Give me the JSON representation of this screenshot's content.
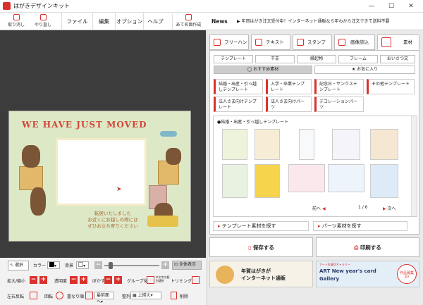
{
  "window": {
    "title": "はがきデザインキット",
    "minimize": "—",
    "maximize": "☐",
    "close": "✕"
  },
  "toolbar": {
    "undo": "取り消し",
    "redo": "やり直し",
    "menus": [
      "ファイル",
      "編集",
      "オプション",
      "ヘルプ"
    ],
    "address_button": "あて名面作成",
    "news_label": "News",
    "news_text": "▶ 年賀はがき注文受付中！インターネット通販なら年わから注文できて送料不要"
  },
  "card": {
    "headline": "WE HAVE JUST MOVED",
    "message_lines": [
      "転居いたしました",
      "お近くにお越しの際には",
      "ぜひお立ち寄りください"
    ]
  },
  "bottom_tools": {
    "select": "選択",
    "color_label": "カラー",
    "background_label": "背景",
    "show_all": "全体表示",
    "zoom": "拡大/縮小",
    "opacity": "透明度",
    "blur": "ぼかす",
    "group": "グループ化",
    "group_hint": "※文字は個別選択",
    "trim": "トリミング",
    "flip": "左右反転",
    "rotate": "回転",
    "stacking": "重なり順",
    "stacking_value": "最前面へ",
    "align": "整列",
    "align_value": "上揃え",
    "delete": "削除"
  },
  "right_panel": {
    "tabs": [
      "フリーハンド",
      "テキスト",
      "スタンプ",
      "画像読込",
      "素材"
    ],
    "subtabs": [
      "テンプレート",
      "干支",
      "縁起物",
      "フレーム",
      "おいさつ文"
    ],
    "recommend": "おすすめ素材",
    "favorites": "お気に入り",
    "categories": [
      "結婚・出産・引っ越しテンプレート",
      "入学・卒業テンプレート",
      "記念日・サンクステンプレート",
      "その他テンプレート",
      "法人さま向けテンプレート",
      "法人さま向けパーツ",
      "デコレーションパーツ"
    ],
    "section_title": "●結婚・出産・引っ越しテンプレート",
    "prev": "前へ",
    "next": "次へ",
    "page": "1 / 6",
    "find_template": "テンプレート素材を探す",
    "find_parts": "パーツ素材を探す",
    "save": "保存する",
    "print": "印刷する",
    "banner1_lines": [
      "年賀はがきが",
      "インターネット通販"
    ],
    "banner2_top": "アート年賀状ギャラリー",
    "banner2_lines": [
      "ART New year's card",
      "Gallery"
    ],
    "banner2_badge": "作品募集中!"
  },
  "colors": {
    "accent": "#d9322c",
    "canvas_bg": "#3c3c3c",
    "card_bg": "#dde9c6"
  }
}
